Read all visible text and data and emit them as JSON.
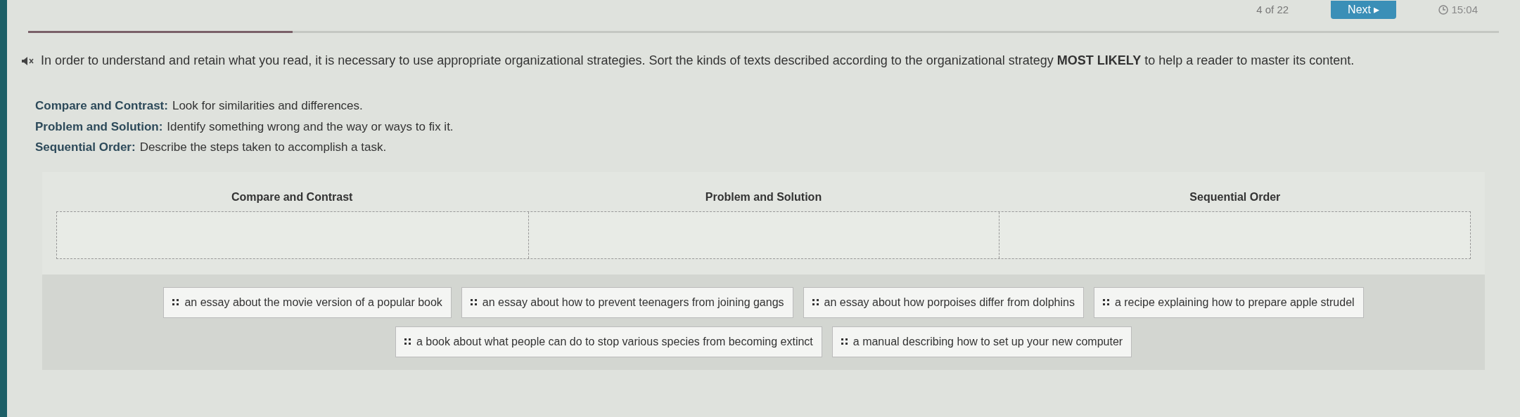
{
  "top_bar": {
    "counter": "4 of 22",
    "next_button": "Next ▸",
    "timer": "15:04",
    "progress": {
      "level": 0.18
    }
  },
  "instruction": "In order to understand and retain what you read, it is necessary to use appropriate organizational strategies. Sort the kinds of texts described according to the organizational strategy **MOST LIKELY** to help a reader to master its content.",
  "definitions": [
    {
      "term": "Compare and Contrast:",
      "text": "Look for similarities and differences."
    },
    {
      "term": "Problem and Solution:",
      "text": "Identify something wrong and the way or ways to fix it."
    },
    {
      "term": "Sequential Order:",
      "text": "Describe the steps taken to accomplish a task."
    }
  ],
  "categories": [
    {
      "label": "Compare and Contrast"
    },
    {
      "label": "Problem and Solution"
    },
    {
      "label": "Sequential Order"
    }
  ],
  "cards": [
    [
      "an essay about the movie version of a popular book",
      "an essay about how to prevent teenagers from joining gangs",
      "an essay about how porpoises differ from dolphins",
      "a recipe explaining how to prepare apple strudel"
    ],
    [
      "a book about what people can do to stop various species from becoming extinct",
      "a manual describing how to set up your new computer"
    ]
  ]
}
